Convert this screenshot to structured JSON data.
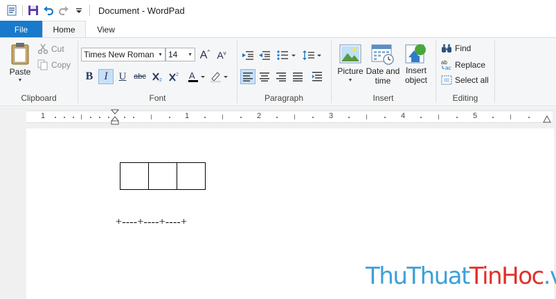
{
  "window": {
    "title": "Document - WordPad"
  },
  "tabs": [
    {
      "label": "File"
    },
    {
      "label": "Home"
    },
    {
      "label": "View"
    }
  ],
  "ribbon": {
    "clipboard": {
      "label": "Clipboard",
      "paste": "Paste",
      "cut": "Cut",
      "copy": "Copy"
    },
    "font": {
      "label": "Font",
      "family": "Times New Roman",
      "size": "14",
      "bold": "B",
      "italic": "I",
      "underline": "U",
      "strike": "abc"
    },
    "paragraph": {
      "label": "Paragraph"
    },
    "insert": {
      "label": "Insert",
      "picture": "Picture",
      "date_time": [
        "Date and",
        "time"
      ],
      "insert_object": [
        "Insert",
        "object"
      ]
    },
    "editing": {
      "label": "Editing",
      "find": "Find",
      "replace": "Replace",
      "select_all": "Select all"
    }
  },
  "ruler": {
    "numbers": [
      "1",
      "1",
      "2",
      "3",
      "4",
      "5"
    ]
  },
  "document": {
    "plain_text": "+----+----+----+"
  },
  "watermark": {
    "parts": [
      "Thu",
      "Thuat",
      "Tin",
      "Hoc",
      ".vn"
    ]
  },
  "colors": {
    "file_tab": "#1979ca",
    "watermark_red": "#e0302a",
    "watermark_blue": "#3da0d8"
  }
}
